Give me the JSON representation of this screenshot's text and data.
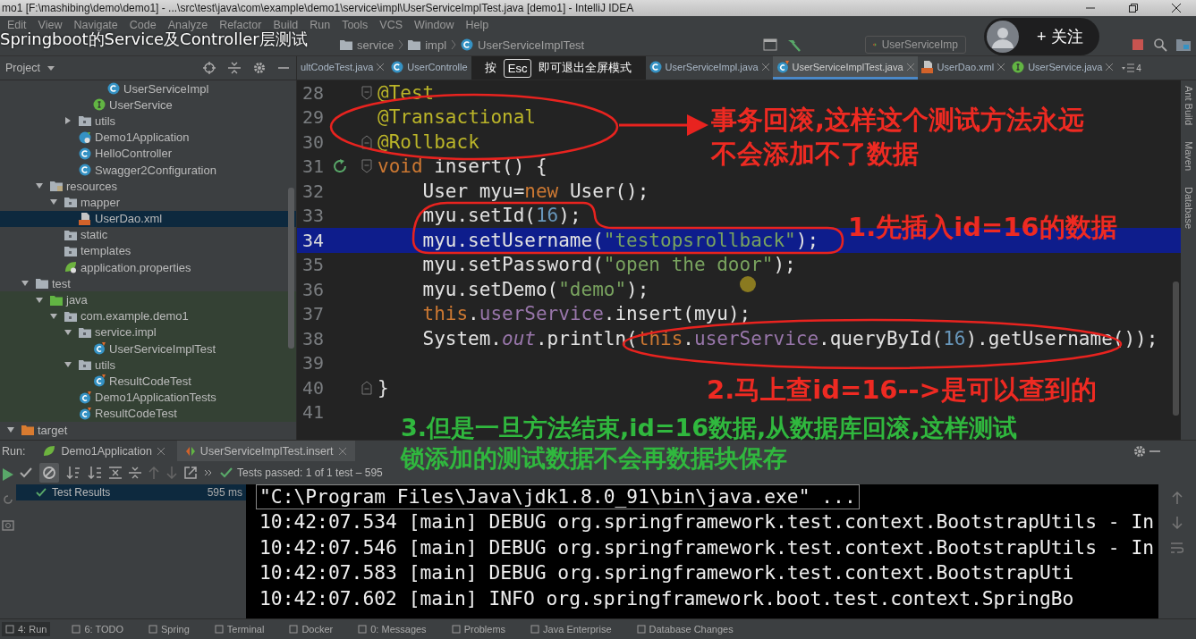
{
  "window": {
    "title": "mo1 [F:\\mashibing\\demo\\demo1] - ...\\src\\test\\java\\com\\example\\demo1\\service\\impl\\UserServiceImplTest.java [demo1] - IntelliJ IDEA"
  },
  "video_overlay": {
    "title": "Springboot的Service及Controller层测试",
    "hint_before": "按",
    "hint_key": "Esc",
    "hint_after": "即可退出全屏模式",
    "follow_button": "+ 关注"
  },
  "menu": [
    "Edit",
    "View",
    "Navigate",
    "Code",
    "Analyze",
    "Refactor",
    "Build",
    "Run",
    "Tools",
    "VCS",
    "Window",
    "Help"
  ],
  "breadcrumbs": [
    "service",
    "impl",
    "UserServiceImplTest"
  ],
  "run_config": "UserServiceImp",
  "project_panel": {
    "title": "Project",
    "tree": [
      {
        "children": [
          {
            "children": [
              {
                "children": [
                  {
                    "children": [
                      {
                        "children": [
                          {
                            "children": [
                              {
                                "label": "UserServiceImpl",
                                "kind": "class",
                                "selected": false
                              }
                            ]
                          },
                          {
                            "label": "UserService",
                            "kind": "interface",
                            "selected": false
                          }
                        ]
                      },
                      {
                        "label": "utils",
                        "kind": "folder",
                        "expanded": false,
                        "selected": false
                      },
                      {
                        "label": "Demo1Application",
                        "kind": "spring-class",
                        "selected": false
                      },
                      {
                        "label": "HelloController",
                        "kind": "class",
                        "selected": false
                      },
                      {
                        "label": "Swagger2Configuration",
                        "kind": "class",
                        "selected": false
                      }
                    ]
                  }
                ]
              },
              {
                "label": "resources",
                "kind": "resources-folder",
                "expanded": true,
                "selected": false,
                "children": [
                  {
                    "label": "mapper",
                    "kind": "folder",
                    "expanded": true,
                    "selected": false,
                    "children": [
                      {
                        "label": "UserDao.xml",
                        "kind": "xml",
                        "selected": true
                      }
                    ]
                  },
                  {
                    "label": "static",
                    "kind": "folder",
                    "selected": false
                  },
                  {
                    "label": "templates",
                    "kind": "folder",
                    "selected": false
                  },
                  {
                    "label": "application.properties",
                    "kind": "properties",
                    "selected": false
                  }
                ]
              }
            ]
          },
          {
            "label": "test",
            "kind": "plain-folder",
            "expanded": true,
            "selected": false,
            "children": [
              {
                "label": "java",
                "kind": "test-source-folder",
                "expanded": true,
                "selected": false,
                "children": [
                  {
                    "label": "com.example.demo1",
                    "kind": "folder",
                    "expanded": true,
                    "selected": false,
                    "children": [
                      {
                        "label": "service.impl",
                        "kind": "folder",
                        "expanded": true,
                        "selected": false,
                        "children": [
                          {
                            "label": "UserServiceImplTest",
                            "kind": "test-class",
                            "selected": false
                          }
                        ]
                      },
                      {
                        "label": "utils",
                        "kind": "folder",
                        "expanded": true,
                        "selected": false,
                        "children": [
                          {
                            "label": "ResultCodeTest",
                            "kind": "test-class",
                            "selected": false
                          }
                        ]
                      },
                      {
                        "label": "Demo1ApplicationTests",
                        "kind": "test-class",
                        "selected": false
                      },
                      {
                        "label": "ResultCodeTest",
                        "kind": "test-class",
                        "selected": false
                      }
                    ]
                  }
                ]
              }
            ]
          }
        ]
      },
      {
        "label": "target",
        "kind": "excluded-folder",
        "expanded": true,
        "selected": false
      }
    ]
  },
  "editor_tabs": [
    {
      "label": "ultCodeTest.java",
      "selected": false
    },
    {
      "label": "UserControlle",
      "kind": "class",
      "selected": false
    },
    {
      "label": "UserServiceImpl.java",
      "kind": "class",
      "selected": false
    },
    {
      "label": "UserServiceImplTest.java",
      "kind": "test-class",
      "selected": true
    },
    {
      "label": "UserDao.xml",
      "kind": "xml",
      "selected": false
    },
    {
      "label": "UserService.java",
      "kind": "interface",
      "selected": false
    }
  ],
  "tabs_overflow": "4",
  "editor": {
    "lines": [
      {
        "number": "28",
        "highlighted": false,
        "indented": false,
        "markers": [
          {
            "kind": "fold-start"
          }
        ],
        "tokens": [
          {
            "text": "@Test",
            "kind": "annotation"
          }
        ]
      },
      {
        "number": "29",
        "highlighted": false,
        "indented": false,
        "tokens": [
          {
            "text": "@Transactional",
            "kind": "annotation"
          }
        ]
      },
      {
        "number": "30",
        "highlighted": false,
        "indented": false,
        "markers": [
          {
            "kind": "fold-end"
          }
        ],
        "tokens": [
          {
            "text": "@Rollback",
            "kind": "annotation"
          }
        ]
      },
      {
        "number": "31",
        "highlighted": false,
        "indented": false,
        "markers": [
          {
            "kind": "run"
          },
          {
            "kind": "fold-start"
          }
        ],
        "tokens": [
          {
            "text": "void ",
            "kind": "keyword"
          },
          {
            "text": "insert() {",
            "kind": "plain"
          }
        ]
      },
      {
        "number": "32",
        "highlighted": false,
        "indented": true,
        "tokens": [
          {
            "text": "User myu=",
            "kind": "plain"
          },
          {
            "text": "new ",
            "kind": "keyword"
          },
          {
            "text": "User();",
            "kind": "plain"
          }
        ]
      },
      {
        "number": "33",
        "highlighted": false,
        "indented": true,
        "tokens": [
          {
            "text": "myu.setId(",
            "kind": "plain"
          },
          {
            "text": "16",
            "kind": "number"
          },
          {
            "text": ");",
            "kind": "plain"
          }
        ]
      },
      {
        "number": "34",
        "highlighted": true,
        "indented": true,
        "tokens": [
          {
            "text": "myu.setUsername(",
            "kind": "plain"
          },
          {
            "text": "\"testopsrollback\"",
            "kind": "string"
          },
          {
            "text": ");",
            "kind": "plain"
          }
        ]
      },
      {
        "number": "35",
        "highlighted": false,
        "indented": true,
        "tokens": [
          {
            "text": "myu.setPassword(",
            "kind": "plain"
          },
          {
            "text": "\"open the door\"",
            "kind": "string"
          },
          {
            "text": ");",
            "kind": "plain"
          }
        ]
      },
      {
        "number": "36",
        "highlighted": false,
        "indented": true,
        "tokens": [
          {
            "text": "myu.setDemo(",
            "kind": "plain"
          },
          {
            "text": "\"demo\"",
            "kind": "string"
          },
          {
            "text": ");",
            "kind": "plain"
          }
        ]
      },
      {
        "number": "37",
        "highlighted": false,
        "indented": true,
        "tokens": [
          {
            "text": "this",
            "kind": "keyword"
          },
          {
            "text": ".",
            "kind": "plain"
          },
          {
            "text": "userService",
            "kind": "field"
          },
          {
            "text": ".insert(myu);",
            "kind": "plain"
          }
        ]
      },
      {
        "number": "38",
        "highlighted": false,
        "indented": true,
        "tokens": [
          {
            "text": "System.",
            "kind": "plain"
          },
          {
            "text": "out",
            "kind": "static"
          },
          {
            "text": ".println(",
            "kind": "plain"
          },
          {
            "text": "this",
            "kind": "keyword"
          },
          {
            "text": ".",
            "kind": "plain"
          },
          {
            "text": "userService",
            "kind": "field"
          },
          {
            "text": ".queryById(",
            "kind": "plain"
          },
          {
            "text": "16",
            "kind": "number"
          },
          {
            "text": ").getUsername());",
            "kind": "plain"
          }
        ]
      },
      {
        "number": "39",
        "highlighted": false
      },
      {
        "number": "40",
        "highlighted": false,
        "indented": false,
        "markers": [
          {
            "kind": "fold-end"
          }
        ],
        "tokens": [
          {
            "text": "}",
            "kind": "plain"
          }
        ]
      },
      {
        "number": "41",
        "highlighted": false
      }
    ]
  },
  "annotations": [
    {
      "kind": "red",
      "lines": [
        "事务回滚,这样这个测试方法永远",
        "不会添加不了数据"
      ]
    },
    {
      "kind": "red",
      "lines": [
        "1.先插入id=16的数据"
      ]
    },
    {
      "kind": "red",
      "lines": [
        "2.马上查id=16-->是可以查到的"
      ]
    },
    {
      "kind": "green",
      "lines": [
        "3.但是一旦方法结束,id=16数据,从数据库回滚,这样测试",
        "锁添加的测试数据不会再数据块保存"
      ]
    }
  ],
  "right_stripe": [
    "Ant Build",
    "Maven",
    "Database"
  ],
  "run_panel": {
    "label": "Run:",
    "tabs": [
      {
        "label": "Demo1Application",
        "kind": "spring",
        "selected": false
      },
      {
        "label": "UserServiceImplTest.insert",
        "kind": "test",
        "selected": true
      }
    ],
    "status": "Tests passed: 1 of 1 test – 595",
    "results": [
      {
        "label": "Test Results",
        "time": "595 ms",
        "selected": true
      }
    ],
    "console": [
      {
        "kind": "command",
        "text": "\"C:\\Program Files\\Java\\jdk1.8.0_91\\bin\\java.exe\" ..."
      },
      {
        "kind": "log",
        "text": "10:42:07.534 [main] DEBUG org.springframework.test.context.BootstrapUtils - In"
      },
      {
        "kind": "log",
        "text": "10:42:07.546 [main] DEBUG org.springframework.test.context.BootstrapUtils - In"
      },
      {
        "kind": "log",
        "text": "10:42:07.583 [main] DEBUG org.springframework.test.context.BootstrapUti"
      },
      {
        "kind": "log",
        "text": "10:42:07.602 [main] INFO org.springframework.boot.test.context.SpringBo"
      }
    ]
  },
  "status_bar": [
    "4: Run",
    "6: TODO",
    "Spring",
    "Terminal",
    "Docker",
    "0: Messages",
    "Problems",
    "Java Enterprise",
    "Database Changes"
  ]
}
